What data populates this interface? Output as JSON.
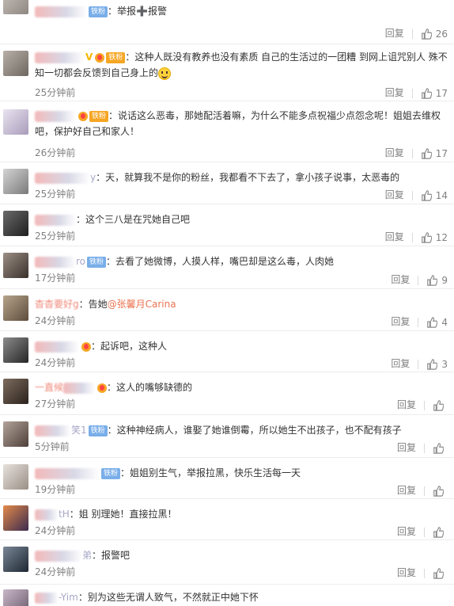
{
  "comments": [
    {
      "badge": "铁粉",
      "text": "：举报➕报警",
      "time": "",
      "reply": "回复",
      "likes": "26"
    },
    {
      "badge": "铁粉",
      "text": "：这种人既没有教养也没有素质 自己的生活过的一团糟 到网上诅咒别人 殊不知一切都会反馈到自己身上的",
      "time": "25分钟前",
      "reply": "回复",
      "likes": "17"
    },
    {
      "badge": "铁粉",
      "text": "：说话这么恶毒，那她配活着嘛，为什么不能多点祝福少点怨念呢！姐姐去维权吧，保护好自己和家人！",
      "time": "26分钟前",
      "reply": "回复",
      "likes": "17"
    },
    {
      "name": "y",
      "text": "：天，就算我不是你的粉丝，我都看不下去了，拿小孩子说事，太恶毒的",
      "time": "25分钟前",
      "reply": "回复",
      "likes": "14"
    },
    {
      "text": "：这个三八是在咒她自己吧",
      "time": "25分钟前",
      "reply": "回复",
      "likes": "12"
    },
    {
      "name": "ro",
      "badge": "铁粉",
      "text": "：去看了她微博，人摸人样，嘴巴却是这么毒，人肉她",
      "time": "17分钟前",
      "reply": "回复",
      "likes": "9"
    },
    {
      "name": "杳杳要好g",
      "text": "：告她",
      "mention": "@张馨月Carina",
      "time": "24分钟前",
      "reply": "回复",
      "likes": "4"
    },
    {
      "text": "：起诉吧，这种人",
      "time": "24分钟前",
      "reply": "回复",
      "likes": "3"
    },
    {
      "name": "一直候",
      "text": "：这人的嘴够缺德的",
      "time": "27分钟前",
      "reply": "回复",
      "likes": ""
    },
    {
      "name": "笑1",
      "badge": "铁粉",
      "text": "：这种神经病人，谁娶了她谁倒霉，所以她生不出孩子，也不配有孩子",
      "time": "5分钟前",
      "reply": "回复",
      "likes": ""
    },
    {
      "badge": "铁粉",
      "text": "：姐姐别生气，举报拉黑，快乐生活每一天",
      "time": "19分钟前",
      "reply": "回复",
      "likes": ""
    },
    {
      "name": "tH",
      "text": "：姐 别理她！直接拉黑！",
      "time": "24分钟前",
      "reply": "回复",
      "likes": ""
    },
    {
      "name": "弟",
      "text": "：报警吧",
      "time": "24分钟前",
      "reply": "回复",
      "likes": ""
    },
    {
      "name": "-Yim",
      "text": "：别为这些无谓人致气，不然就正中她下怀",
      "time": "",
      "reply": "",
      "likes": ""
    }
  ],
  "colors": {
    "text": "#333333",
    "meta": "#808080",
    "mention": "#eb7350",
    "badge": "#79aee9"
  }
}
